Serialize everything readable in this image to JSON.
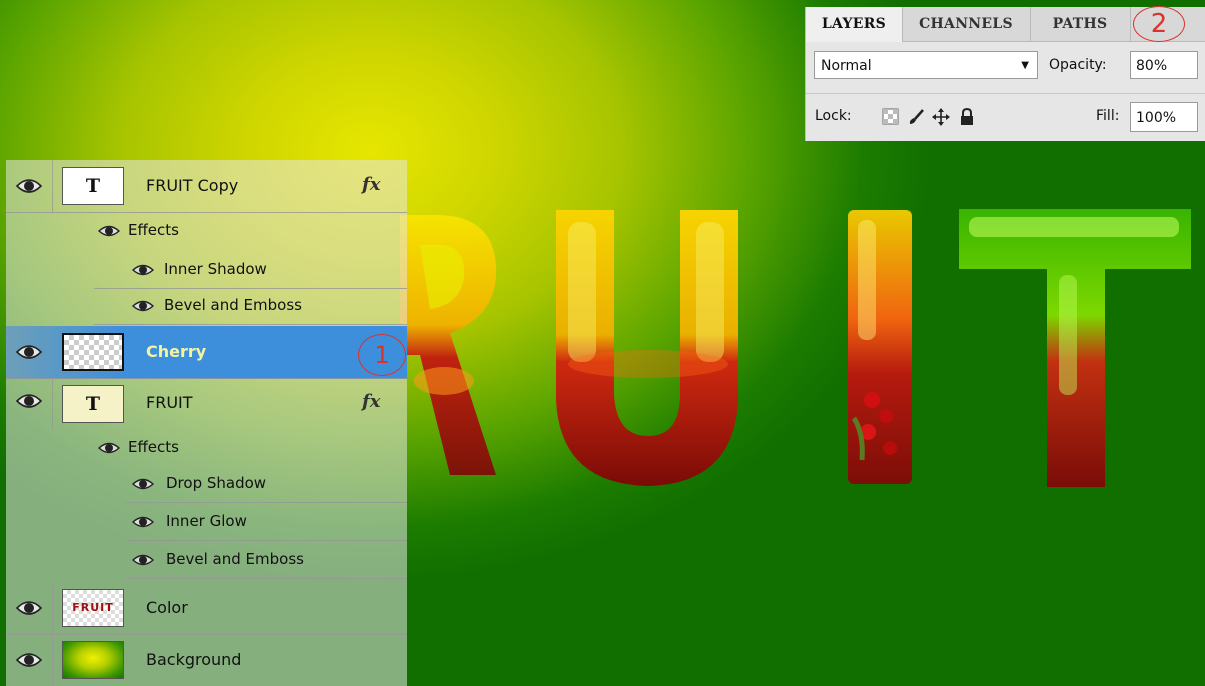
{
  "canvas": {
    "text": "FRUIT"
  },
  "layers_panel": {
    "tabs": [
      {
        "label": "LAYERS",
        "active": true
      },
      {
        "label": "CHANNELS",
        "active": false
      },
      {
        "label": "PATHS",
        "active": false
      }
    ],
    "blend_mode": "Normal",
    "opacity_label": "Opacity:",
    "opacity_value": "80%",
    "lock_label": "Lock:",
    "fill_label": "Fill:",
    "fill_value": "100%"
  },
  "layers": [
    {
      "name": "FRUIT Copy",
      "type": "text",
      "thumb": "T",
      "fx": "fx",
      "effects_label": "Effects",
      "effects": [
        "Inner Shadow",
        "Bevel and Emboss"
      ]
    },
    {
      "name": "Cherry",
      "type": "image",
      "selected": true
    },
    {
      "name": "FRUIT",
      "type": "text",
      "thumb": "T",
      "fx": "fx",
      "effects_label": "Effects",
      "effects": [
        "Drop Shadow",
        "Inner Glow",
        "Bevel and Emboss"
      ]
    },
    {
      "name": "Color",
      "type": "image",
      "thumb": "FRUIT"
    },
    {
      "name": "Background",
      "type": "image"
    }
  ],
  "annotations": {
    "one": "1",
    "two": "2"
  },
  "colors": {
    "selection": "#3d8fdc",
    "annotation": "#d8332c"
  }
}
